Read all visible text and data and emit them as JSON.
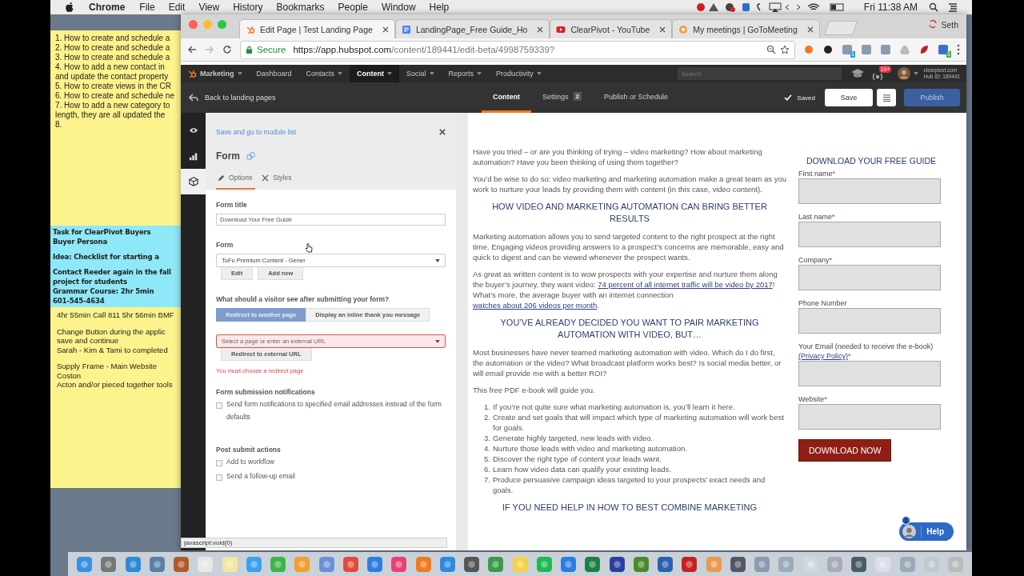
{
  "menu_bar": {
    "app_name": "Chrome",
    "menus": [
      "File",
      "Edit",
      "View",
      "History",
      "Bookmarks",
      "People",
      "Window",
      "Help"
    ],
    "clock": "Fri 11:38 AM"
  },
  "sticky_note": {
    "top_lines": [
      "1. How to create and schedule a",
      "2. How to create and schedule a",
      "3. How to create and schedule a",
      "4. How to add a new contact in",
      "and update the contact property",
      "5. How to create views in the CR",
      "6. How to create and schedule ne",
      "7. How to add a new category to",
      "length, they are all updated the",
      "8."
    ],
    "blue_groups": [
      {
        "lines": [
          "Task for ClearPivot Buyers",
          "Buyer Persona"
        ]
      },
      {
        "lines": [
          "Idea: Checklist for starting a"
        ]
      },
      {
        "lines": [
          "Contact Reeder again in the fall",
          "project for students",
          "Grammar Course: 2hr 5min",
          "601-545-4634"
        ]
      }
    ],
    "bottom_groups": [
      {
        "lines": [
          "4hr 55min Call 811 5hr 56min BMF"
        ]
      },
      {
        "lines": [
          "Change Button during the applic",
          "save and continue",
          "Sarah - Kim & Tami to completed"
        ]
      },
      {
        "lines": [
          "Supply Frame - Main Website",
          "Coston",
          "Acton and/or pieced together tools"
        ]
      }
    ]
  },
  "browser": {
    "tabs": [
      {
        "kind": "hubspot",
        "title": "Edit Page | Test Landing Page",
        "selected": true
      },
      {
        "kind": "doc",
        "title": "LandingPage_Free Guide_Ho",
        "selected": false
      },
      {
        "kind": "youtube",
        "title": "ClearPivot - YouTube",
        "selected": false
      },
      {
        "kind": "meeting",
        "title": "My meetings | GoToMeeting",
        "selected": false
      }
    ],
    "profile": "Seth",
    "security": "Secure",
    "url_host": "https://app.hubspot.com",
    "url_path": "/content/189441/edit-beta/4998759339?",
    "extensions": [
      {
        "kind": "sprocket"
      },
      {
        "kind": "lens"
      },
      {
        "kind": "tile",
        "badge": "1"
      },
      {
        "kind": "tile"
      },
      {
        "kind": "tile"
      },
      {
        "kind": "drive"
      },
      {
        "kind": "leaf"
      },
      {
        "kind": "code",
        "badge": "1"
      }
    ]
  },
  "nav": {
    "items": [
      {
        "label": "Marketing",
        "dropdown": true,
        "selected": false
      },
      {
        "label": "Dashboard",
        "dropdown": false,
        "selected": false
      },
      {
        "label": "Contacts",
        "dropdown": true,
        "selected": false
      },
      {
        "label": "Content",
        "dropdown": true,
        "selected": true
      },
      {
        "label": "Social",
        "dropdown": true,
        "selected": false
      },
      {
        "label": "Reports",
        "dropdown": true,
        "selected": false
      },
      {
        "label": "Productivity",
        "dropdown": true,
        "selected": false
      }
    ],
    "search_placeholder": "Search",
    "notification_badge": "10+",
    "account_domain": "clearpivot.com",
    "hub_id": "Hub ID: 189441"
  },
  "editor_bar": {
    "back": "Back to landing pages",
    "tabs": [
      {
        "label": "Content",
        "selected": true
      },
      {
        "label": "Settings",
        "badge": "2",
        "selected": false
      },
      {
        "label": "Publish or Schedule",
        "selected": false
      }
    ],
    "status": "Saved",
    "save": "Save",
    "publish": "Publish"
  },
  "rail": [
    {
      "kind": "eye",
      "selected": false
    },
    {
      "kind": "chart",
      "selected": false
    },
    {
      "kind": "cube",
      "selected": true
    }
  ],
  "panel": {
    "back_link": "Save and go to module list",
    "title": "Form",
    "tabs": [
      {
        "kind": "pencil",
        "label": "Options",
        "selected": true
      },
      {
        "kind": "brush",
        "label": "Styles",
        "selected": false
      }
    ],
    "form_title": {
      "label": "Form title",
      "value": "Download Your Free Guide"
    },
    "form": {
      "label": "Form",
      "value": "ToFu Premium Content - Gener",
      "buttons": [
        "Edit",
        "Add new"
      ]
    },
    "after_submit": {
      "label": "What should a visitor see after submitting your form?",
      "options": [
        {
          "label": "Redirect to another page",
          "selected": true
        },
        {
          "label": "Display an inline thank you message",
          "selected": false
        }
      ],
      "placeholder": "Select a page or enter an external URL",
      "invalid": true,
      "button": "Redirect to external URL",
      "error": "You must choose a redirect page"
    },
    "notifications": {
      "label": "Form submission notifications",
      "checkboxes": [
        {
          "label": "Send form notifications to specified email addresses instead of the form defaults",
          "checked": false
        }
      ]
    },
    "post_submit": {
      "label": "Post submit actions",
      "checkboxes": [
        {
          "label": "Add to workflow",
          "checked": false
        },
        {
          "label": "Send a follow-up email",
          "checked": false
        }
      ]
    }
  },
  "preview": {
    "blocks": [
      {
        "kind": "p",
        "text": "Have you tried – or are you thinking of trying – video marketing? How about marketing automation? Have you been thinking of using them together?"
      },
      {
        "kind": "p",
        "text": "You’d be wise to do so: video marketing and marketing automation make a great team as you work to nurture your leads by providing them with content  (in this case, video content)."
      },
      {
        "kind": "h",
        "text": "HOW VIDEO AND MARKETING AUTOMATION CAN BRING BETTER RESULTS"
      },
      {
        "kind": "p",
        "text": "Marketing automation allows you to send targeted content to the right prospect at the right time. Engaging videos providing answers to a prospect’s concerns are memorable, easy and quick to digest and can be viewed whenever the prospect wants."
      },
      {
        "kind": "p",
        "segments": [
          {
            "kind": "text",
            "text": "As great as written content is to wow prospects with your expertise and nurture them along the buyer’s journey, they want video: "
          },
          {
            "kind": "link",
            "text": "74 percent of all internet traffic will be video by 2017"
          },
          {
            "kind": "text",
            "text": "! What’s more, the average buyer with an internet connection "
          },
          {
            "kind": "link",
            "text": "watches about 206 videos per month"
          },
          {
            "kind": "text",
            "text": "."
          }
        ]
      },
      {
        "kind": "h",
        "text": "YOU’VE ALREADY DECIDED YOU WANT TO PAIR MARKETING AUTOMATION WITH VIDEO, BUT…"
      },
      {
        "kind": "p",
        "text": "Most businesses have never teamed marketing automation with video. Which do I do first, the automation or the video? What broadcast platform works best? Is social media better, or will email provide me with a better ROI?"
      },
      {
        "kind": "p",
        "text": "This free PDF e-book will guide you."
      },
      {
        "kind": "ol",
        "items": [
          {
            "number": "1.",
            "text": "If you’re not quite sure what marketing automation is, you’ll learn it here."
          },
          {
            "number": "2.",
            "text": "Create and set goals that will impact which type of marketing automation will work best for goals."
          },
          {
            "number": "3.",
            "text": "Generate highly targeted, new leads with video."
          },
          {
            "number": "4.",
            "text": "Nurture those leads with video and marketing automation."
          },
          {
            "number": "5.",
            "text": "Discover the right type of content your leads want."
          },
          {
            "number": "6.",
            "text": "Learn how video data can qualify your existing leads."
          },
          {
            "number": "7.",
            "text": "Produce persuasive campaign ideas targeted to your prospects’ exact needs and goals."
          }
        ]
      },
      {
        "kind": "h",
        "text": "IF YOU NEED HELP IN HOW TO BEST COMBINE MARKETING"
      }
    ]
  },
  "signup_form": {
    "heading": "DOWNLOAD YOUR FREE GUIDE",
    "fields": [
      {
        "label": "First name",
        "mark": "*"
      },
      {
        "label": "Last name",
        "mark": "*"
      },
      {
        "label": "Company",
        "mark": "*"
      },
      {
        "label": "Phone Number"
      },
      {
        "label": "Your Email (needed to receive the e-book)",
        "link": "(Privacy Policy)",
        "mark": "*"
      },
      {
        "label": "Website",
        "mark": "*"
      }
    ],
    "button": "DOWNLOAD NOW"
  },
  "help": {
    "label": "Help",
    "badge": "1"
  },
  "status_bar": "javascript:void(0)"
}
